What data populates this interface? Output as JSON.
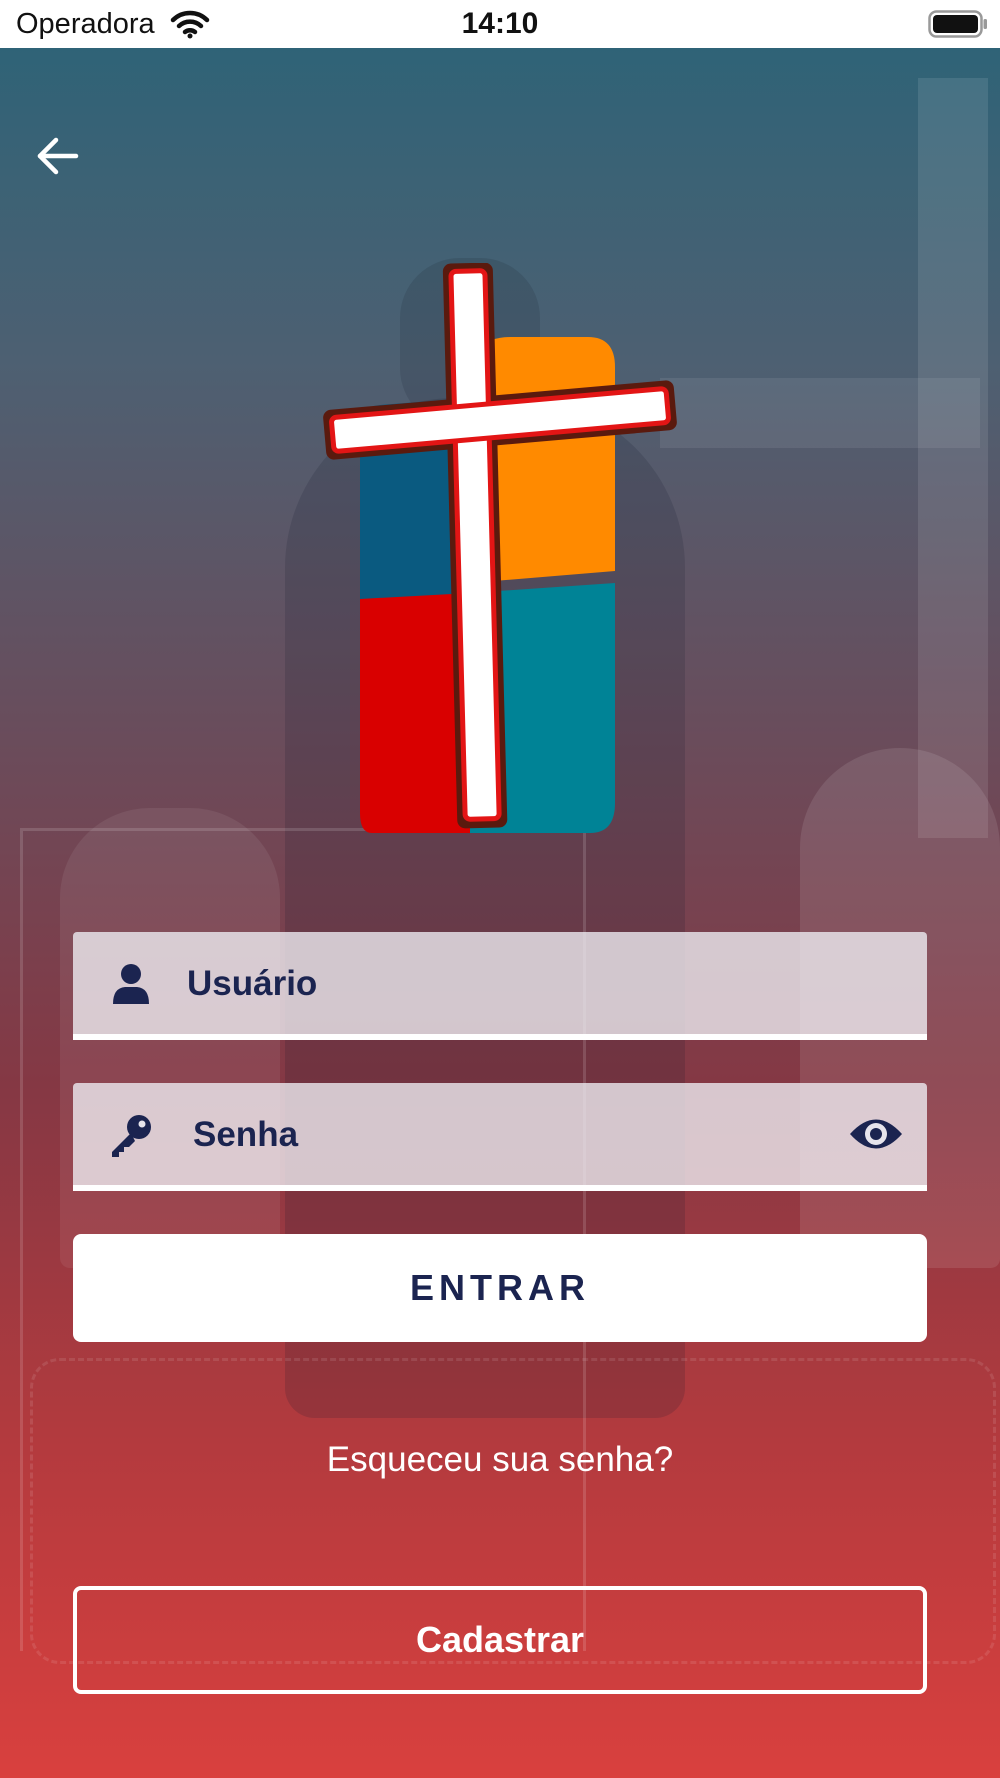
{
  "status_bar": {
    "carrier": "Operadora",
    "time": "14:10",
    "icons": [
      "wifi-icon",
      "battery-icon"
    ]
  },
  "navigation": {
    "back_icon": "arrow-left-icon"
  },
  "logo": {
    "icon": "church-cross-logo",
    "colors": {
      "blue": "#0a5a80",
      "orange": "#ff8a00",
      "red": "#d90000",
      "teal": "#008396",
      "cross_outline": "#5a1a0e",
      "cross_border": "#e31515",
      "cross_fill": "#ffffff"
    }
  },
  "form": {
    "user": {
      "placeholder": "Usuário",
      "value": "",
      "icon": "user-icon"
    },
    "password": {
      "placeholder": "Senha",
      "value": "",
      "icon": "key-icon",
      "toggle_icon": "eye-icon"
    },
    "login_label": "ENTRAR",
    "forgot_label": "Esqueceu sua senha?",
    "register_label": "Cadastrar"
  },
  "colors": {
    "text_dark_blue": "#1b2450",
    "gradient_top": "#2f6377",
    "gradient_bottom": "#d9403e",
    "button_bg": "#ffffff"
  }
}
